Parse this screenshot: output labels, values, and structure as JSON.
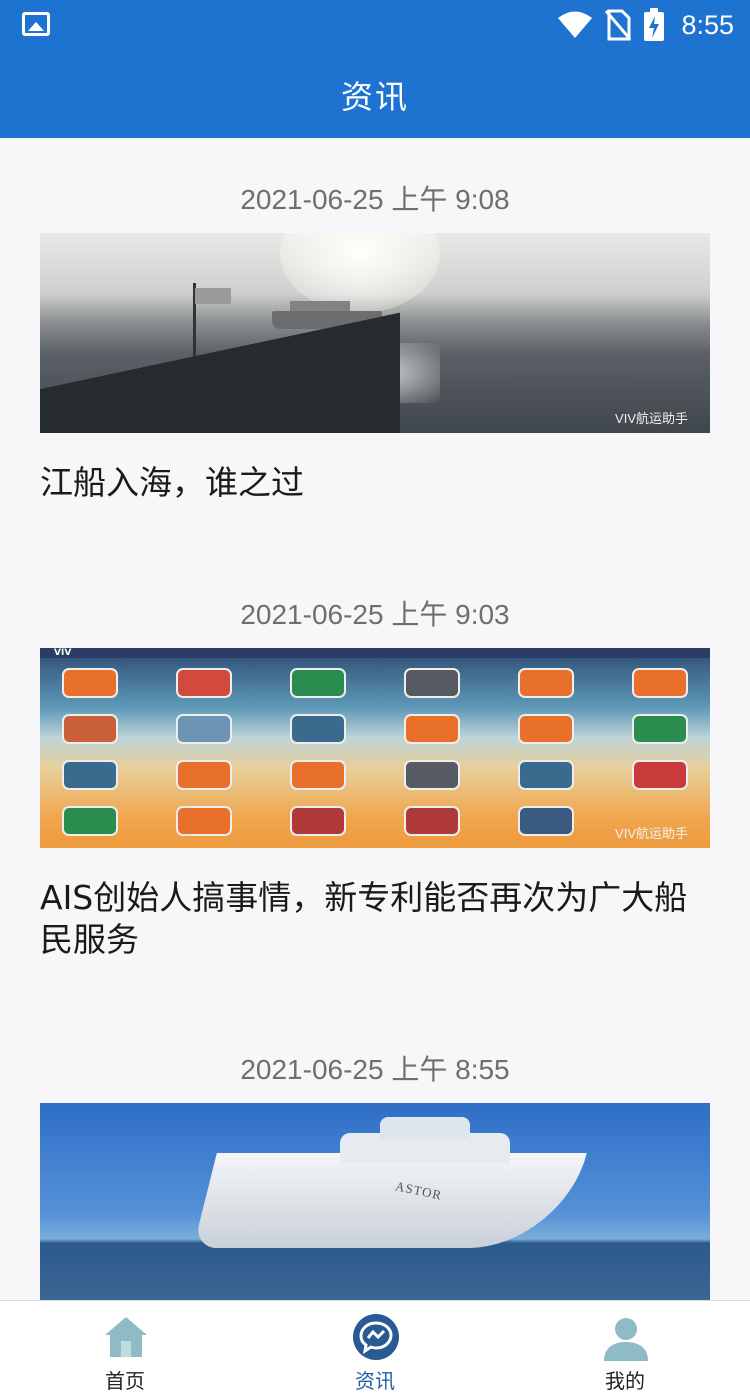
{
  "status_bar": {
    "time": "8:55",
    "icons": [
      "image-icon",
      "wifi-icon",
      "no-sim-icon",
      "battery-charging-icon"
    ]
  },
  "app_bar": {
    "title": "资讯"
  },
  "articles": [
    {
      "date": "2021-06-25 上午 9:08",
      "title": "江船入海，谁之过",
      "image_watermark": "VIV航运助手"
    },
    {
      "date": "2021-06-25 上午 9:03",
      "title": "AIS创始人搞事情，新专利能否再次为广大船民服务",
      "image_watermark": "VIV航运助手"
    },
    {
      "date": "2021-06-25 上午 8:55",
      "title": "",
      "image_label": "ASTOR"
    }
  ],
  "bottom_nav": {
    "items": [
      {
        "label": "首页",
        "icon": "home-icon",
        "active": false
      },
      {
        "label": "资讯",
        "icon": "chat-icon",
        "active": true
      },
      {
        "label": "我的",
        "icon": "person-icon",
        "active": false
      }
    ],
    "active_color": "#1f5fa8",
    "inactive_icon_color": "#7fb2bd"
  },
  "colors": {
    "primary": "#1f73d0",
    "background": "#f7f7f9"
  }
}
